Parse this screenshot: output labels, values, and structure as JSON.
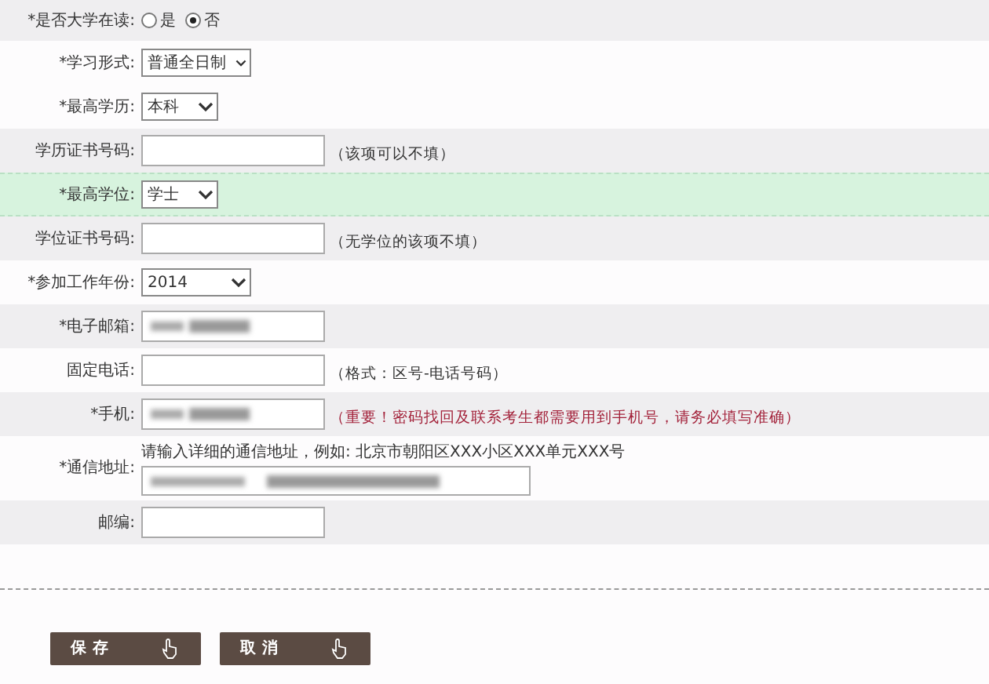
{
  "form": {
    "rows": [
      {
        "kind": "radio",
        "label": "*是否大学在读:",
        "shaded": true,
        "highlighted": false,
        "options": [
          {
            "label": "是",
            "selected": false
          },
          {
            "label": "否",
            "selected": true
          }
        ]
      },
      {
        "kind": "select",
        "label": "*学习形式:",
        "shaded": false,
        "highlighted": false,
        "value": "普通全日制"
      },
      {
        "kind": "select",
        "label": "*最高学历:",
        "shaded": false,
        "highlighted": false,
        "value": "本科"
      },
      {
        "kind": "text",
        "label": "学历证书号码:",
        "shaded": true,
        "highlighted": false,
        "note": "（该项可以不填）"
      },
      {
        "kind": "select",
        "label": "*最高学位:",
        "highlighted": true,
        "value": "学士"
      },
      {
        "kind": "text",
        "label": "学位证书号码:",
        "shaded": true,
        "highlighted": false,
        "note": "（无学位的该项不填）"
      },
      {
        "kind": "select",
        "label": "*参加工作年份:",
        "shaded": false,
        "highlighted": false,
        "value": "2014"
      },
      {
        "kind": "text",
        "label": "*电子邮箱:",
        "shaded": true,
        "highlighted": false,
        "redacted": true
      },
      {
        "kind": "text",
        "label": "固定电话:",
        "shaded": false,
        "highlighted": false,
        "note": "（格式：区号-电话号码）"
      },
      {
        "kind": "text",
        "label": "*手机:",
        "shaded": true,
        "highlighted": false,
        "redacted": true,
        "note": "（重要！密码找回及联系考生都需要用到手机号，请务必填写准确）",
        "note_warning": true
      },
      {
        "kind": "address",
        "label": "*通信地址:",
        "shaded": false,
        "highlighted": false,
        "hint": "请输入详细的通信地址，例如: 北京市朝阳区XXX小区XXX单元XXX号",
        "redacted": true
      },
      {
        "kind": "text",
        "label": "邮编:",
        "shaded": true,
        "highlighted": false
      }
    ]
  },
  "buttons": [
    {
      "label": "保存"
    },
    {
      "label": "取消"
    }
  ]
}
